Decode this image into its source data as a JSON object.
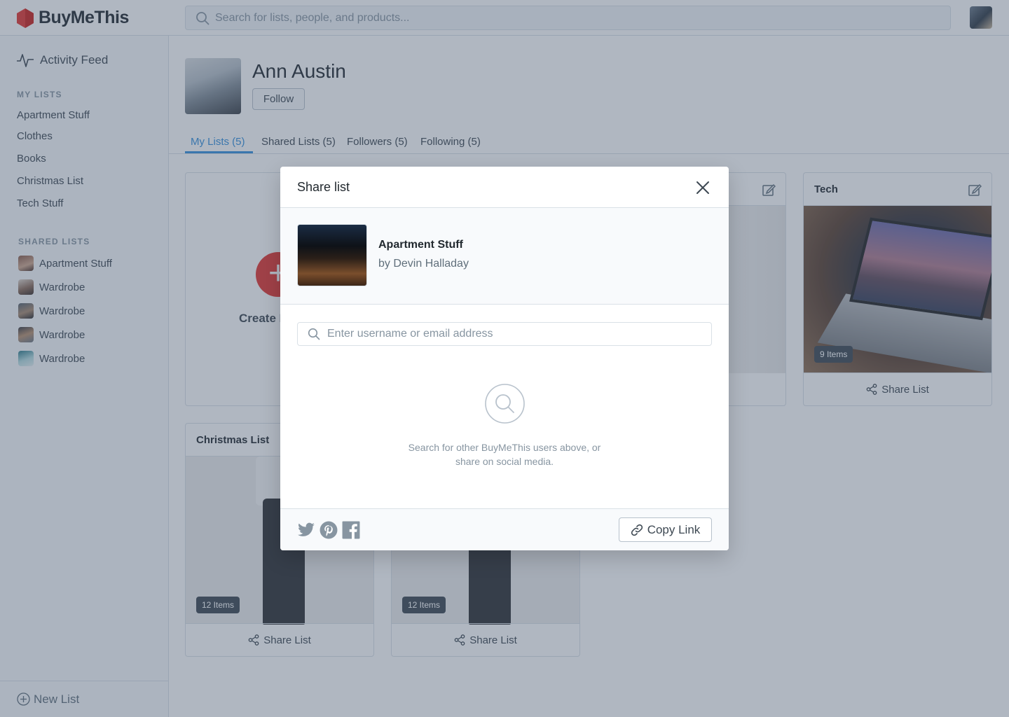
{
  "app": {
    "brand": "BuyMeThis"
  },
  "header": {
    "search_placeholder": "Search for lists, people, and products..."
  },
  "sidebar": {
    "activity_feed": "Activity Feed",
    "my_lists_heading": "MY LISTS",
    "my_lists": [
      "Apartment Stuff",
      "Clothes",
      "Books",
      "Christmas List",
      "Tech Stuff"
    ],
    "shared_lists_heading": "SHARED LISTS",
    "shared_lists": [
      "Apartment Stuff",
      "Wardrobe",
      "Wardrobe",
      "Wardrobe",
      "Wardrobe"
    ],
    "new_list": "New List"
  },
  "profile": {
    "name": "Ann Austin",
    "follow_label": "Follow",
    "tabs": [
      "My Lists (5)",
      "Shared Lists (5)",
      "Followers (5)",
      "Following (5)"
    ],
    "active_tab": "My Lists (5)"
  },
  "cards": {
    "create_label": "Create N",
    "tech": {
      "title": "Tech",
      "items": "9 Items",
      "share": "Share List"
    },
    "christmas": {
      "title": "Christmas List",
      "items": "12 Items",
      "share": "Share List"
    },
    "second_bottom": {
      "items": "12 Items",
      "share": "Share List"
    }
  },
  "modal": {
    "title": "Share list",
    "list_name": "Apartment Stuff",
    "list_owner": "by Devin Halladay",
    "search_placeholder": "Enter username or email address",
    "empty_message": "Search for other BuyMeThis users above, or share on social media.",
    "copy_link": "Copy Link"
  },
  "colors": {
    "accent": "#3490dc",
    "brand": "#e3342f",
    "overlay": "#42546c"
  }
}
